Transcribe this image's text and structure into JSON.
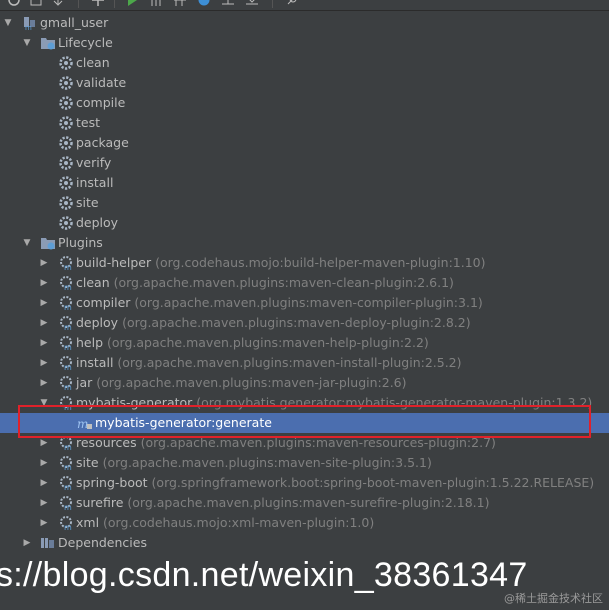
{
  "project": {
    "name": "gmall_user"
  },
  "lifecycle": {
    "label": "Lifecycle",
    "phases": [
      "clean",
      "validate",
      "compile",
      "test",
      "package",
      "verify",
      "install",
      "site",
      "deploy"
    ]
  },
  "plugins": {
    "label": "Plugins",
    "items": [
      {
        "name": "build-helper",
        "detail": "(org.codehaus.mojo:build-helper-maven-plugin:1.10)"
      },
      {
        "name": "clean",
        "detail": "(org.apache.maven.plugins:maven-clean-plugin:2.6.1)"
      },
      {
        "name": "compiler",
        "detail": "(org.apache.maven.plugins:maven-compiler-plugin:3.1)"
      },
      {
        "name": "deploy",
        "detail": "(org.apache.maven.plugins:maven-deploy-plugin:2.8.2)"
      },
      {
        "name": "help",
        "detail": "(org.apache.maven.plugins:maven-help-plugin:2.2)"
      },
      {
        "name": "install",
        "detail": "(org.apache.maven.plugins:maven-install-plugin:2.5.2)"
      },
      {
        "name": "jar",
        "detail": "(org.apache.maven.plugins:maven-jar-plugin:2.6)"
      },
      {
        "name": "mybatis-generator",
        "detail": "(org.mybatis.generator:mybatis-generator-maven-plugin:1.3.2)"
      },
      {
        "name": "resources",
        "detail": "(org.apache.maven.plugins:maven-resources-plugin:2.7)"
      },
      {
        "name": "site",
        "detail": "(org.apache.maven.plugins:maven-site-plugin:3.5.1)"
      },
      {
        "name": "spring-boot",
        "detail": "(org.springframework.boot:spring-boot-maven-plugin:1.5.22.RELEASE)"
      },
      {
        "name": "surefire",
        "detail": "(org.apache.maven.plugins:maven-surefire-plugin:2.18.1)"
      },
      {
        "name": "xml",
        "detail": "(org.codehaus.mojo:xml-maven-plugin:1.0)"
      }
    ],
    "goal": "mybatis-generator:generate"
  },
  "dependencies": {
    "label": "Dependencies"
  },
  "watermark": {
    "url": "s://blog.csdn.net/weixin_38361347",
    "community": "@稀土掘金技术社区"
  },
  "colors": {
    "background": "#3c3f41",
    "selection": "#4b6eaf",
    "highlight": "#e0212a",
    "text": "#bbbbbb",
    "detail": "#808080"
  }
}
